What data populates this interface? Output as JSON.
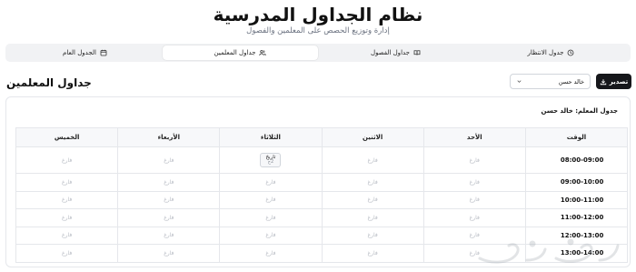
{
  "header": {
    "title": "نظام الجداول المدرسية",
    "subtitle": "إدارة وتوزيع الحصص على المعلمين والفصول"
  },
  "tabs": [
    {
      "label": "جدول الانتظار",
      "icon": "clock-icon",
      "active": false
    },
    {
      "label": "جداول الفصول",
      "icon": "book-icon",
      "active": false
    },
    {
      "label": "جداول المعلمين",
      "icon": "users-icon",
      "active": true
    },
    {
      "label": "الجدول العام",
      "icon": "calendar-icon",
      "active": false
    }
  ],
  "toolbar": {
    "section_title": "جداول المعلمين",
    "selected_teacher": "خالد حسن",
    "export_label": "تصدير"
  },
  "schedule": {
    "title": "جدول المعلم: خالد حسن",
    "columns": [
      "الوقت",
      "الأحد",
      "الاثنين",
      "الثلاثاء",
      "الأربعاء",
      "الخميس"
    ],
    "rows": [
      {
        "time": "08:00-09:00",
        "cells": [
          "فارغ",
          "فارغ",
          {
            "subject": "تاريخ",
            "class": "2ج"
          },
          "فارغ",
          "فارغ"
        ]
      },
      {
        "time": "09:00-10:00",
        "cells": [
          "فارغ",
          "فارغ",
          "فارغ",
          "فارغ",
          "فارغ"
        ]
      },
      {
        "time": "10:00-11:00",
        "cells": [
          "فارغ",
          "فارغ",
          "فارغ",
          "فارغ",
          "فارغ"
        ]
      },
      {
        "time": "11:00-12:00",
        "cells": [
          "فارغ",
          "فارغ",
          "فارغ",
          "فارغ",
          "فارغ"
        ]
      },
      {
        "time": "12:00-13:00",
        "cells": [
          "فارغ",
          "فارغ",
          "فارغ",
          "فارغ",
          "فارغ"
        ]
      },
      {
        "time": "13:00-14:00",
        "cells": [
          "فارغ",
          "فارغ",
          "فارغ",
          "فارغ",
          "فارغ"
        ]
      }
    ]
  },
  "colors": {
    "accent_dark": "#16171b",
    "tab_bar_bg": "#f1f2f4",
    "header_row_bg": "#f7f8fa",
    "empty_text": "#b8bcc4"
  }
}
